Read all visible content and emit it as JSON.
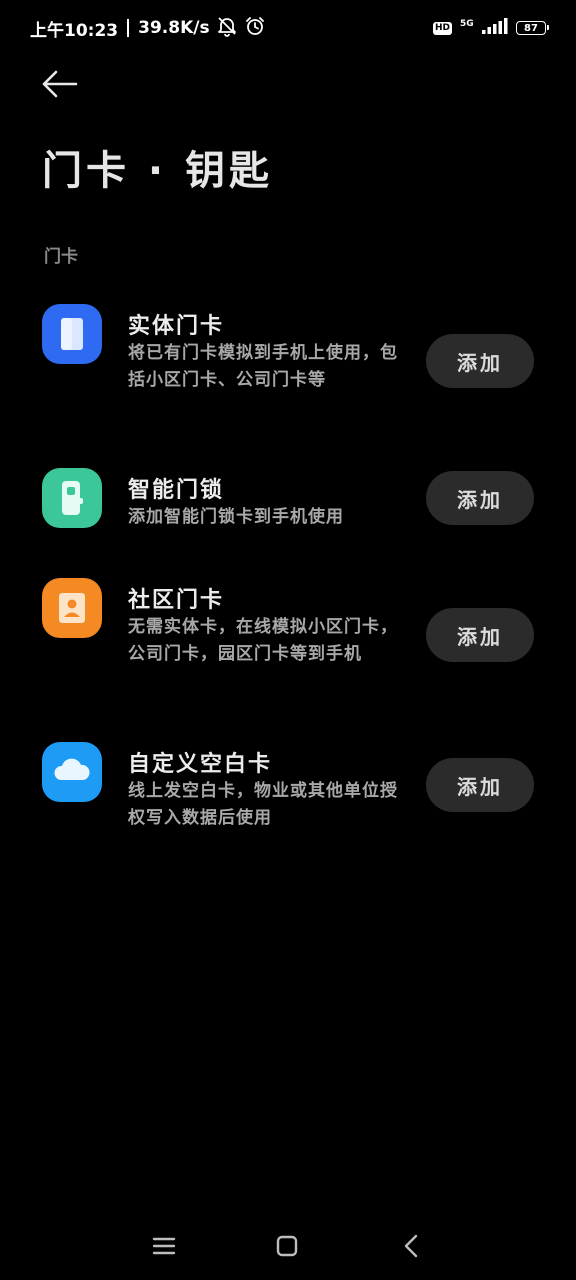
{
  "status_bar": {
    "time": "上午10:23",
    "net_speed": "39.8K/s",
    "network": "5G",
    "hd": "HD",
    "battery": "87"
  },
  "header": {
    "title": "门卡 · 钥匙"
  },
  "section": {
    "label": "门卡"
  },
  "cards": [
    {
      "title": "实体门卡",
      "description": "将已有门卡模拟到手机上使用，包括小区门卡、公司门卡等",
      "button": "添加",
      "icon": "card-icon",
      "color": "#2f6bf2"
    },
    {
      "title": "智能门锁",
      "description": "添加智能门锁卡到手机使用",
      "button": "添加",
      "icon": "smart-lock-icon",
      "color": "#3cc79a"
    },
    {
      "title": "社区门卡",
      "description": "无需实体卡，在线模拟小区门卡，公司门卡，园区门卡等到手机",
      "button": "添加",
      "icon": "community-card-icon",
      "color": "#f58a24"
    },
    {
      "title": "自定义空白卡",
      "description": "线上发空白卡，物业或其他单位授权写入数据后使用",
      "button": "添加",
      "icon": "cloud-icon",
      "color": "#1e9cf5"
    }
  ]
}
